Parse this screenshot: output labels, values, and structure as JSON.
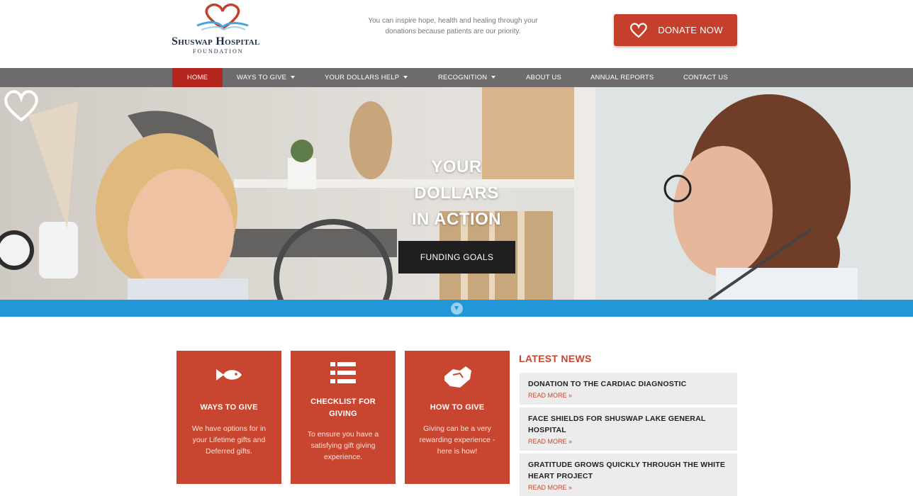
{
  "header": {
    "logo_name": "Shuswap Hospital",
    "logo_sub": "FOUNDATION",
    "tagline": "You can inspire hope, health and healing through your donations because patients are our priority.",
    "donate_label": "DONATE NOW"
  },
  "nav": {
    "items": [
      {
        "label": "HOME",
        "active": true,
        "dropdown": false
      },
      {
        "label": "WAYS TO GIVE",
        "dropdown": true
      },
      {
        "label": "YOUR DOLLARS HELP",
        "dropdown": true
      },
      {
        "label": "RECOGNITION",
        "dropdown": true
      },
      {
        "label": "ABOUT US",
        "dropdown": false
      },
      {
        "label": "ANNUAL REPORTS",
        "dropdown": false
      },
      {
        "label": "CONTACT US",
        "dropdown": false
      }
    ]
  },
  "hero": {
    "title_lines": [
      "YOUR",
      "DOLLARS",
      "IN ACTION"
    ],
    "button_label": "FUNDING GOALS"
  },
  "cards": [
    {
      "icon": "fish-icon",
      "title": "WAYS TO GIVE",
      "text": "We have options for in your Lifetime gifts and Deferred gifts."
    },
    {
      "icon": "list-icon",
      "title": "CHECKLIST FOR GIVING",
      "text": "To ensure you have a satisfying gift giving experience."
    },
    {
      "icon": "handshake-icon",
      "title": "HOW TO GIVE",
      "text": "Giving can be a very rewarding experience - here is how!"
    }
  ],
  "news": {
    "heading": "LATEST NEWS",
    "read_more": "READ MORE »",
    "items": [
      {
        "title": "DONATION TO THE CARDIAC DIAGNOSTIC"
      },
      {
        "title": "FACE SHIELDS FOR SHUSWAP LAKE GENERAL HOSPITAL"
      },
      {
        "title": "GRATITUDE GROWS QUICKLY THROUGH THE WHITE HEART PROJECT"
      }
    ]
  },
  "colors": {
    "brand_red": "#c84630",
    "nav_grey": "#6d6b6b",
    "active_nav": "#b3261e",
    "accent_blue": "#2196d8"
  }
}
